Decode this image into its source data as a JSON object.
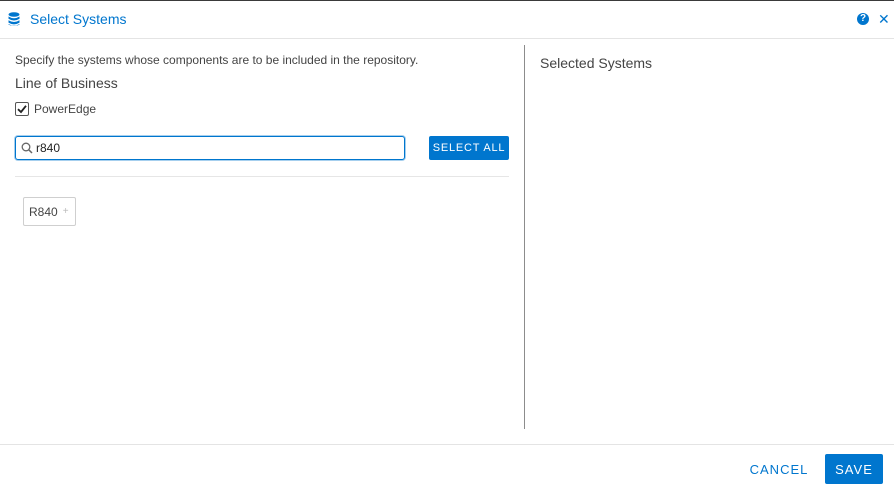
{
  "dialog": {
    "title": "Select Systems",
    "icons": {
      "title": "database-icon",
      "help": "help-icon",
      "close": "close-icon"
    },
    "help_glyph": "?",
    "close_glyph": "✕"
  },
  "left_panel": {
    "instructions": "Specify the systems whose components are to be included in the repository.",
    "line_of_business_label": "Line of Business",
    "line_of_business_options": [
      {
        "label": "PowerEdge",
        "checked": true
      }
    ],
    "search": {
      "value": "r840",
      "placeholder": ""
    },
    "select_all_label": "SELECT ALL",
    "results": [
      {
        "label": "R840",
        "action_glyph": "+"
      }
    ]
  },
  "right_panel": {
    "title": "Selected Systems",
    "items": []
  },
  "footer": {
    "cancel_label": "CANCEL",
    "save_label": "SAVE"
  },
  "colors": {
    "accent": "#0076ce",
    "text": "#444444",
    "divider": "#e4e4e4"
  }
}
